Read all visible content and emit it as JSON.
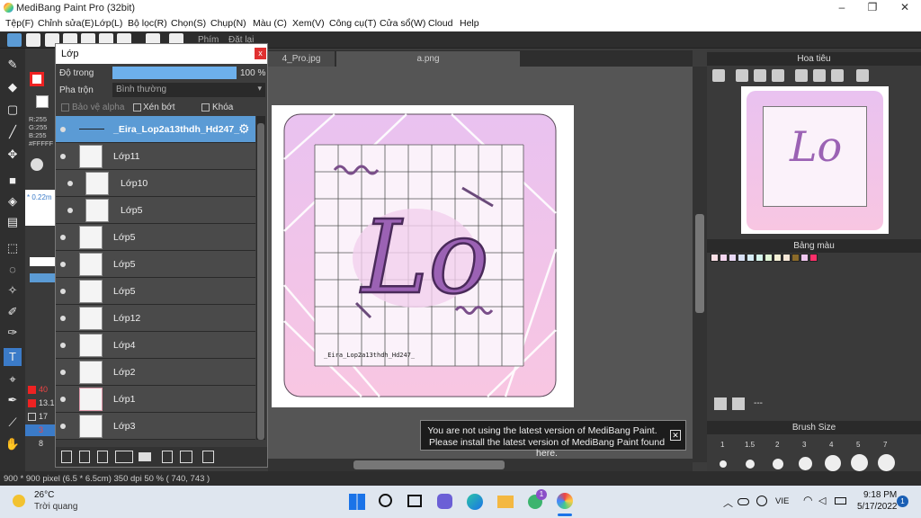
{
  "window": {
    "title": "MediBang Paint Pro (32bit)"
  },
  "menu": [
    "Tệp(F)",
    "Chỉnh sửa(E)",
    "Lớp(L)",
    "Bộ lọc(R)",
    "Chọn(S)",
    "Chụp(N)",
    "Màu (C)",
    "Xem(V)",
    "Công cụ(T)",
    "Cửa sổ(W)",
    "Cloud",
    "Help"
  ],
  "toolbar": {
    "phim_label": "Phím",
    "reset_label": "Đặt lại"
  },
  "left_panel": {
    "rgb": [
      "R:255",
      "G:255",
      "B:255"
    ],
    "hex": "#FFFFF",
    "size_hint": "* 0.22m",
    "brush_sizes": [
      "40",
      "13.1",
      "17",
      "3",
      "8"
    ]
  },
  "tabs": [
    "4_Pro.jpg",
    "a.png"
  ],
  "layer_panel": {
    "title": "Lớp",
    "opacity_label": "Độ trong",
    "opacity_value": "100 %",
    "opacity": 1.0,
    "blend_label": "Pha trộn",
    "blend_value": "Bình thường",
    "protect_alpha": "Bảo vệ alpha",
    "clipping": "Xén bớt",
    "lock": "Khóa",
    "layers": [
      {
        "name": "_Eira_Lop2a13thdh_Hd247_",
        "selected": true
      },
      {
        "name": "Lớp11"
      },
      {
        "name": "Lớp10"
      },
      {
        "name": "Lớp5"
      },
      {
        "name": "Lớp5"
      },
      {
        "name": "Lớp5"
      },
      {
        "name": "Lớp5"
      },
      {
        "name": "Lớp12"
      },
      {
        "name": "Lớp4"
      },
      {
        "name": "Lớp2"
      },
      {
        "name": "Lớp1"
      },
      {
        "name": "Lớp3"
      }
    ]
  },
  "canvas": {
    "art_text": "Lo",
    "signature": "_Eira_Lop2a13thdh_Hd247_"
  },
  "right_panel": {
    "navigator_title": "Hoa tiêu",
    "palette_title": "Bảng màu",
    "palette_placeholder": "---",
    "brush_size_title": "Brush Size",
    "brush_sizes": [
      "1",
      "1.5",
      "2",
      "3",
      "4",
      "5",
      "7"
    ]
  },
  "palette_colors": [
    "#fbe0e6",
    "#f5d6f0",
    "#e8d8f5",
    "#d8e0f5",
    "#d6ecf5",
    "#d6f5ec",
    "#e0f5d6",
    "#f5f0d6",
    "#f5e6d6",
    "#8a6a2a",
    "#f0c8f0",
    "#ff2f6a"
  ],
  "notice": {
    "line1": "You are not using the latest version of MediBang Paint.",
    "line2": "Please install the latest version of MediBang Paint found here."
  },
  "status": {
    "text": "900 * 900 pixel  (6.5 * 6.5cm)  350 dpi  50 %  ( 740, 743 )"
  },
  "taskbar": {
    "temp": "26°C",
    "weather": "Trời quang",
    "lang": "VIE",
    "time": "9:18 PM",
    "date": "5/17/2022",
    "notif_count": "1",
    "app_badge": "1"
  }
}
